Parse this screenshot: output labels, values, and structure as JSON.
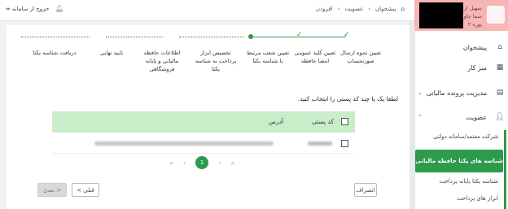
{
  "topbar": {
    "exit_label": "خروج از سامانه",
    "breadcrumbs": [
      "پیشخوان",
      "عضویت",
      "افزودن"
    ]
  },
  "user": {
    "text": "سهیل از سما جاوا پوره ۲"
  },
  "sidebar": {
    "items": [
      {
        "label": "پیشخوان",
        "icon": "home-icon"
      },
      {
        "label": "میز کار",
        "icon": "desk-icon"
      },
      {
        "label": "مدیریت پرونده مالیاتی",
        "icon": "file-icon"
      },
      {
        "label": "عضویت",
        "icon": "user-icon"
      }
    ],
    "subitems": [
      {
        "label": "شرکت معتمد/سامانه دولتی"
      },
      {
        "label": "شناسه های یکتا حافظه مالیاتی"
      },
      {
        "label": "شناسه یکتا پایانه پرداخت"
      },
      {
        "label": "ابزار های پرداخت"
      }
    ]
  },
  "stepper": {
    "steps": [
      {
        "label": "تعیین نحوه ارسال صورتحساب"
      },
      {
        "label": "تعیین کلید عمومی امضا حافظه"
      },
      {
        "label": "تعیین شعب مرتبط با شناسه یکتا"
      },
      {
        "label": "تخصیص ابزار پرداخت به شناسه یکتا"
      },
      {
        "label": "اطلاعات حافظه مالیاتی و پایانه فروشگاهی"
      },
      {
        "label": "تایید نهایی"
      },
      {
        "label": "دریافت شناسه یکتا"
      }
    ]
  },
  "main": {
    "prompt": "لطفا یک یا چند کد پستی را انتخاب کنید.",
    "table": {
      "headers": [
        "کد پستی",
        "آدرس"
      ]
    },
    "pagination": {
      "current": "1",
      "first": "«",
      "prev": "‹",
      "next": "›",
      "last": "»"
    },
    "buttons": {
      "cancel": "انصراف",
      "prev": "< قبلی",
      "next": "بعدی >"
    }
  }
}
